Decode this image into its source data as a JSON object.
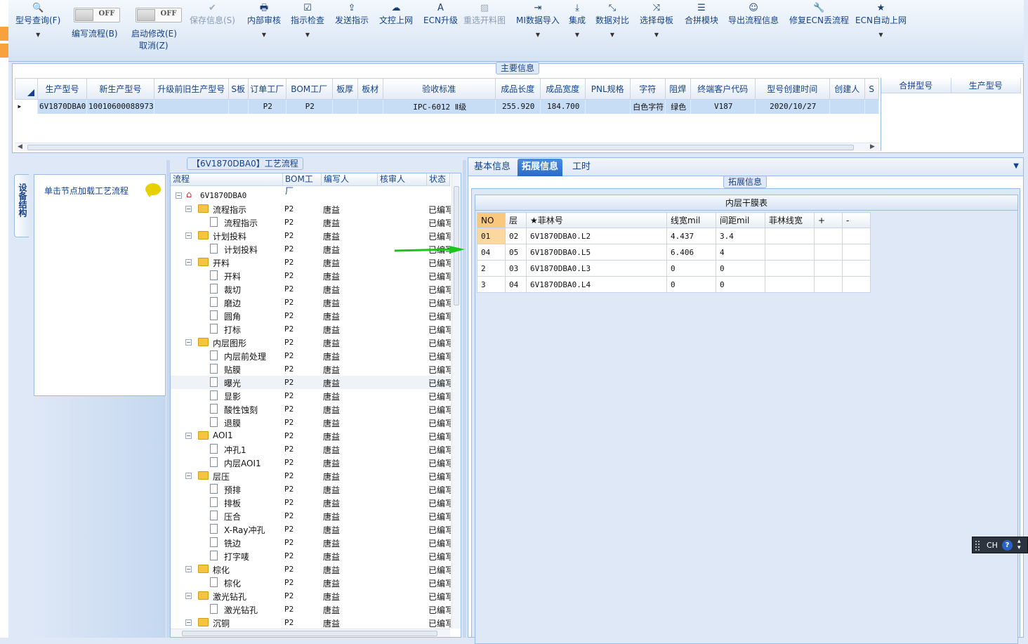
{
  "toolbar": {
    "items": [
      {
        "label": "型号查询(F)",
        "icon": "search-icon",
        "glyph": "🔍",
        "dropdown": true,
        "disabled": false
      },
      {
        "label": "保存信息(S)",
        "icon": "check-icon",
        "glyph": "✔",
        "dropdown": false,
        "disabled": true
      },
      {
        "label": "内部审核",
        "icon": "printer-icon",
        "glyph": "🖶",
        "dropdown": true,
        "disabled": false
      },
      {
        "label": "指示检查",
        "icon": "checkbox-icon",
        "glyph": "☑",
        "dropdown": true,
        "disabled": false
      },
      {
        "label": "发送指示",
        "icon": "upload-icon",
        "glyph": "⇪",
        "dropdown": false,
        "disabled": false
      },
      {
        "label": "文控上网",
        "icon": "cloud-upload-icon",
        "glyph": "☁",
        "dropdown": false,
        "disabled": false
      },
      {
        "label": "ECN升级",
        "icon": "font-icon",
        "glyph": "A",
        "dropdown": false,
        "disabled": false
      },
      {
        "label": "重选开料图",
        "icon": "image-icon",
        "glyph": "▨",
        "dropdown": false,
        "disabled": true
      },
      {
        "label": "MI数据导入",
        "icon": "sign-in-icon",
        "glyph": "⇥",
        "dropdown": true,
        "disabled": false
      },
      {
        "label": "集成",
        "icon": "download-icon",
        "glyph": "⤓",
        "dropdown": true,
        "disabled": false
      },
      {
        "label": "数据对比",
        "icon": "compress-icon",
        "glyph": "⤡",
        "dropdown": true,
        "disabled": false
      },
      {
        "label": "选择母板",
        "icon": "shuffle-icon",
        "glyph": "⤨",
        "dropdown": true,
        "disabled": false
      },
      {
        "label": "合拼模块",
        "icon": "list-icon",
        "glyph": "☰",
        "dropdown": false,
        "disabled": false
      },
      {
        "label": "导出流程信息",
        "icon": "smile-icon",
        "glyph": "☺",
        "dropdown": false,
        "disabled": false
      },
      {
        "label": "修复ECN丢流程",
        "icon": "wrench-icon",
        "glyph": "🔧",
        "dropdown": false,
        "disabled": false
      },
      {
        "label": "ECN自动上网",
        "icon": "star-icon",
        "glyph": "★",
        "dropdown": true,
        "disabled": false
      }
    ],
    "toggles": [
      {
        "state": "OFF",
        "label": "编写流程(B)"
      },
      {
        "state": "OFF",
        "label": "启动修改(E)",
        "sublabel": "取消(Z)"
      }
    ]
  },
  "main_info": {
    "title": "主要信息",
    "columns": [
      "生产型号",
      "新生产型号",
      "升级前旧生产型号",
      "S板",
      "订单工厂",
      "BOM工厂",
      "板厚",
      "板材",
      "验收标准",
      "成品长度",
      "成品宽度",
      "PNL规格",
      "字符",
      "阻焊",
      "终端客户代码",
      "型号创建时间",
      "创建人",
      "S"
    ],
    "row": [
      "6V1870DBA0",
      "10010600088973",
      "",
      "",
      "P2",
      "P2",
      "",
      "",
      "IPC-6012 Ⅱ级",
      "255.920",
      "184.700",
      "",
      "白色字符",
      "绿色",
      "V187",
      "2020/10/27",
      "",
      ""
    ],
    "merge_columns": [
      "合拼型号",
      "生产型号"
    ]
  },
  "left": {
    "side_tab": "设备结构",
    "hint": "单击节点加载工艺流程"
  },
  "process": {
    "title": "【6V1870DBA0】工艺流程",
    "columns": [
      "流程",
      "BOM工厂",
      "编写人",
      "核审人",
      "状态"
    ],
    "rows": [
      {
        "level": 0,
        "type": "root",
        "name": "6V1870DBA0",
        "bom": "",
        "writer": "",
        "status": ""
      },
      {
        "level": 1,
        "type": "folder",
        "name": "流程指示",
        "bom": "P2",
        "writer": "唐益",
        "status": "已编写"
      },
      {
        "level": 2,
        "type": "doc",
        "name": "流程指示",
        "bom": "P2",
        "writer": "唐益",
        "status": "已编写"
      },
      {
        "level": 1,
        "type": "folder",
        "name": "计划投料",
        "bom": "P2",
        "writer": "唐益",
        "status": "已编写"
      },
      {
        "level": 2,
        "type": "doc",
        "name": "计划投料",
        "bom": "P2",
        "writer": "唐益",
        "status": "已编写"
      },
      {
        "level": 1,
        "type": "folder",
        "name": "开料",
        "bom": "P2",
        "writer": "唐益",
        "status": "已编写"
      },
      {
        "level": 2,
        "type": "doc",
        "name": "开料",
        "bom": "P2",
        "writer": "唐益",
        "status": "已编写"
      },
      {
        "level": 2,
        "type": "doc",
        "name": "裁切",
        "bom": "P2",
        "writer": "唐益",
        "status": "已编写"
      },
      {
        "level": 2,
        "type": "doc",
        "name": "磨边",
        "bom": "P2",
        "writer": "唐益",
        "status": "已编写"
      },
      {
        "level": 2,
        "type": "doc",
        "name": "圆角",
        "bom": "P2",
        "writer": "唐益",
        "status": "已编写"
      },
      {
        "level": 2,
        "type": "doc",
        "name": "打标",
        "bom": "P2",
        "writer": "唐益",
        "status": "已编写"
      },
      {
        "level": 1,
        "type": "folder",
        "name": "内层图形",
        "bom": "P2",
        "writer": "唐益",
        "status": "已编写"
      },
      {
        "level": 2,
        "type": "doc",
        "name": "内层前处理",
        "bom": "P2",
        "writer": "唐益",
        "status": "已编写"
      },
      {
        "level": 2,
        "type": "doc",
        "name": "贴膜",
        "bom": "P2",
        "writer": "唐益",
        "status": "已编写"
      },
      {
        "level": 2,
        "type": "doc",
        "name": "曝光",
        "bom": "P2",
        "writer": "唐益",
        "status": "已编写",
        "selected": true
      },
      {
        "level": 2,
        "type": "doc",
        "name": "显影",
        "bom": "P2",
        "writer": "唐益",
        "status": "已编写"
      },
      {
        "level": 2,
        "type": "doc",
        "name": "酸性蚀刻",
        "bom": "P2",
        "writer": "唐益",
        "status": "已编写"
      },
      {
        "level": 2,
        "type": "doc",
        "name": "退膜",
        "bom": "P2",
        "writer": "唐益",
        "status": "已编写"
      },
      {
        "level": 1,
        "type": "folder",
        "name": "AOI1",
        "bom": "P2",
        "writer": "唐益",
        "status": "已编写"
      },
      {
        "level": 2,
        "type": "doc",
        "name": "冲孔1",
        "bom": "P2",
        "writer": "唐益",
        "status": "已编写"
      },
      {
        "level": 2,
        "type": "doc",
        "name": "内层AOI1",
        "bom": "P2",
        "writer": "唐益",
        "status": "已编写"
      },
      {
        "level": 1,
        "type": "folder",
        "name": "层压",
        "bom": "P2",
        "writer": "唐益",
        "status": "已编写"
      },
      {
        "level": 2,
        "type": "doc",
        "name": "预排",
        "bom": "P2",
        "writer": "唐益",
        "status": "已编写"
      },
      {
        "level": 2,
        "type": "doc",
        "name": "排板",
        "bom": "P2",
        "writer": "唐益",
        "status": "已编写"
      },
      {
        "level": 2,
        "type": "doc",
        "name": "压合",
        "bom": "P2",
        "writer": "唐益",
        "status": "已编写"
      },
      {
        "level": 2,
        "type": "doc",
        "name": "X-Ray冲孔",
        "bom": "P2",
        "writer": "唐益",
        "status": "已编写"
      },
      {
        "level": 2,
        "type": "doc",
        "name": "铣边",
        "bom": "P2",
        "writer": "唐益",
        "status": "已编写"
      },
      {
        "level": 2,
        "type": "doc",
        "name": "打字唛",
        "bom": "P2",
        "writer": "唐益",
        "status": "已编写"
      },
      {
        "level": 1,
        "type": "folder",
        "name": "棕化",
        "bom": "P2",
        "writer": "唐益",
        "status": "已编写"
      },
      {
        "level": 2,
        "type": "doc",
        "name": "棕化",
        "bom": "P2",
        "writer": "唐益",
        "status": "已编写"
      },
      {
        "level": 1,
        "type": "folder",
        "name": "激光钻孔",
        "bom": "P2",
        "writer": "唐益",
        "status": "已编写"
      },
      {
        "level": 2,
        "type": "doc",
        "name": "激光钻孔",
        "bom": "P2",
        "writer": "唐益",
        "status": "已编写"
      },
      {
        "level": 1,
        "type": "folder",
        "name": "沉铜",
        "bom": "P2",
        "writer": "唐益",
        "status": "已编写"
      }
    ]
  },
  "right": {
    "tabs": [
      {
        "label": "基本信息",
        "active": false
      },
      {
        "label": "拓展信息",
        "active": true
      },
      {
        "label": "工时",
        "active": false
      }
    ],
    "section_title": "拓展信息",
    "table_title": "内层干膜表",
    "film_columns": [
      "NO",
      "层",
      "★菲林号",
      "线宽mil",
      "间距mil",
      "菲林线宽",
      "+",
      "-"
    ],
    "film_rows": [
      [
        "01",
        "02",
        "6V1870DBA0.L2",
        "4.437",
        "3.4",
        "",
        "",
        ""
      ],
      [
        "04",
        "05",
        "6V1870DBA0.L5",
        "6.406",
        "4",
        "",
        "",
        ""
      ],
      [
        "2",
        "03",
        "6V1870DBA0.L3",
        "0",
        "0",
        "",
        "",
        ""
      ],
      [
        "3",
        "04",
        "6V1870DBA0.L4",
        "0",
        "0",
        "",
        "",
        ""
      ]
    ]
  },
  "ime": {
    "label": "CH",
    "help": "?"
  }
}
